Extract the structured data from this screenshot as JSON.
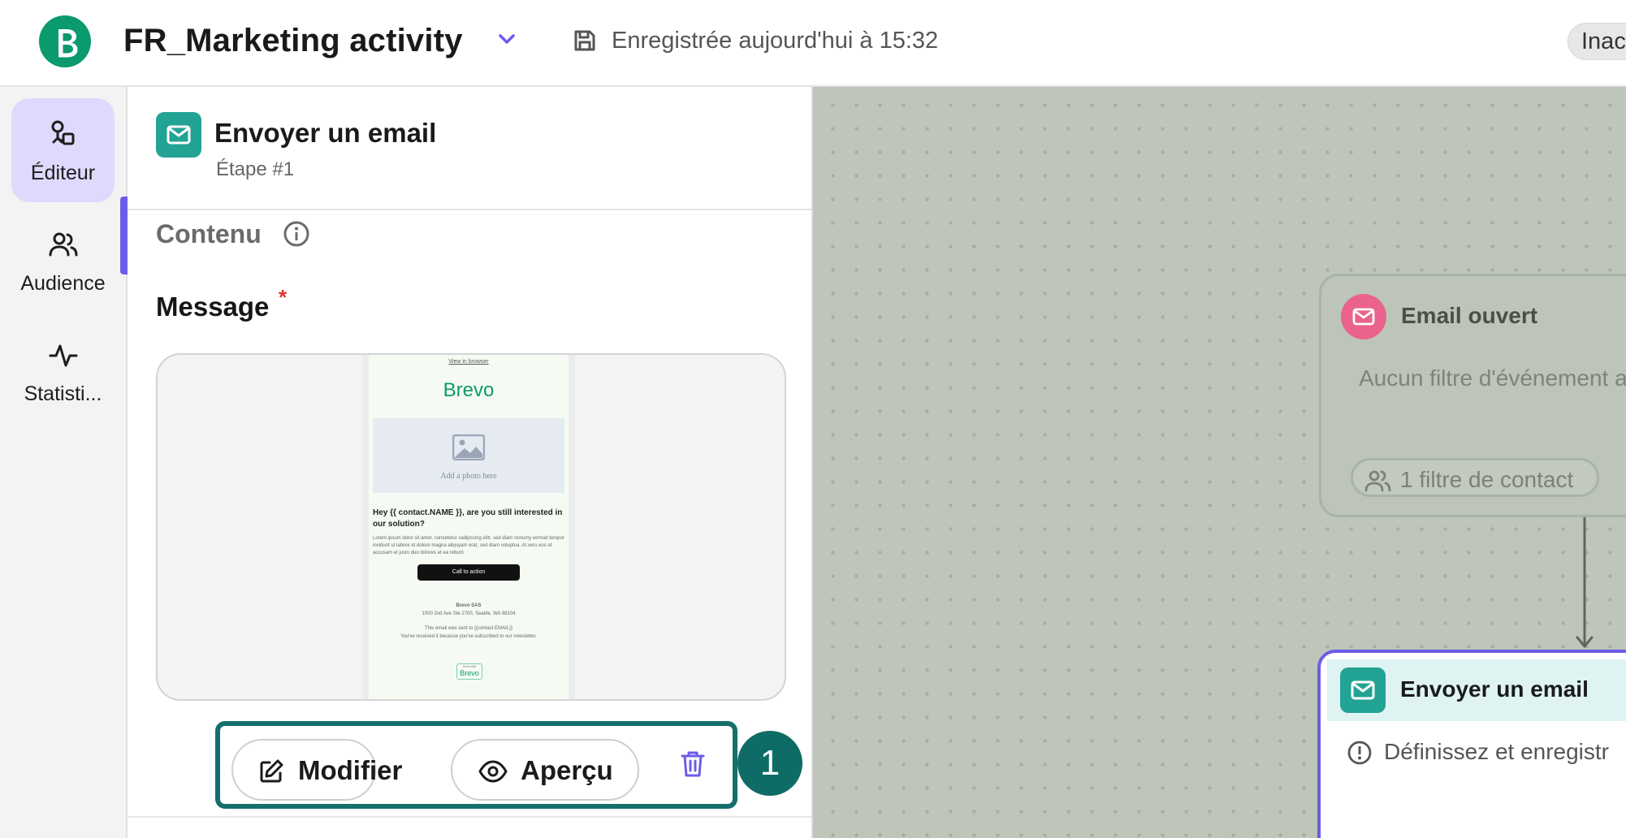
{
  "header": {
    "workflow_title": "FR_Marketing activity",
    "save_status": "Enregistrée aujourd'hui à 15:32",
    "status_pill": "Inac",
    "brand_color": "#0b996e"
  },
  "nav": {
    "items": [
      {
        "label": "Éditeur",
        "icon": "workflow-editor-icon",
        "active": true
      },
      {
        "label": "Audience",
        "icon": "users-icon",
        "active": false
      },
      {
        "label": "Statisti...",
        "icon": "activity-pulse-icon",
        "active": false
      }
    ],
    "active_color": "#dedafd",
    "indicator_color": "#6c5ce7"
  },
  "panel": {
    "step_title": "Envoyer un email",
    "step_subtitle": "Étape #1",
    "content_label": "Contenu",
    "message_label": "Message",
    "required_mark": "*",
    "email_preview": {
      "view_link": "View in browser",
      "brand": "Brevo",
      "photo_placeholder": "Add a photo here",
      "heading": "Hey {{ contact.NAME }}, are you still interested in our solution?",
      "body": "Lorem ipsum dolor sit amet, consetetur sadipscing elitr, sed diam nonumy eirmod tempor invidunt ut labore et dolore magna aliquyam erat, sed diam voluptua. At vero eos et accusam et justo duo dolores et ea rebum.",
      "cta": "Call to action",
      "company": "Brevo SAS",
      "address": "1000 2nd Ave Ste 2700, Seattle, WA 98104",
      "sent_to": "This email was sent to {{contact.EMAIL}}",
      "reason": "You've received it because you've subscribed to our newsletter.",
      "badge_top": "Sent with",
      "badge_brand": "Brevo"
    },
    "actions": {
      "edit_label": "Modifier",
      "preview_label": "Aperçu",
      "delete_icon": "trash-icon"
    },
    "step_marker": "1",
    "accent_color": "#23a394",
    "frame_color": "#166f6b"
  },
  "canvas": {
    "trigger_node": {
      "title": "Email ouvert",
      "description": "Aucun filtre d'événement a",
      "chip_label": "1 filtre de contact",
      "icon_color": "#e9638c"
    },
    "action_node": {
      "title": "Envoyer un email",
      "description": "Définissez et enregistr",
      "border_color": "#6c5ce7"
    }
  }
}
